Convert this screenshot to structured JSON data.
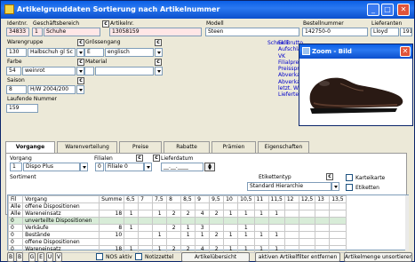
{
  "window": {
    "title": "Artikelgrunddaten Sortierung nach Artikelnummer",
    "accent": "#0b5fe6"
  },
  "header": {
    "identnr_label": "Identnr.",
    "identnr": "34833",
    "geschaeft_label": "Geschäftsbereich",
    "geschaeft_code": "1",
    "geschaeft": "Schuhe",
    "artikelnr_label": "Artikelnr.",
    "artikelnr": "13058159",
    "modell_label": "Modell",
    "modell": "Steen",
    "bestellnummer_label": "Bestellnummer",
    "bestellnummer": "142750-0",
    "lieferanten_label": "Lieferanten",
    "lieferant": "Lloyd",
    "lieferant_nr": "1918"
  },
  "left": {
    "warengruppe_label": "Warengruppe",
    "warengruppe_code": "130",
    "warengruppe": "Halbschuh gl Sc",
    "groessengang_label": "Grössengang",
    "groessengang_code": "E",
    "groessengang": "englisch",
    "farbe_label": "Farbe",
    "farbe_code": "54",
    "farbe": "weinrot",
    "material_label": "Material",
    "saison_label": "Saison",
    "saison_code": "8",
    "saison": "H/W 2004/200",
    "laufende_label": "Laufende Nummer",
    "laufende": "159"
  },
  "side_letters": "Schnelli",
  "links": [
    "Ek Brutto",
    "Aufschlagsfa",
    "VK",
    "Filialpreise",
    "Preissprunge",
    "Abverkauf-M",
    "Abverkauf-We",
    "letzt. Warene",
    "Lieferterm"
  ],
  "zoom": {
    "title": "Zoom - Bild"
  },
  "tabs": [
    "Vorgange",
    "Warenverteilung",
    "Preise",
    "Rabatte",
    "Prämien",
    "Eigenschaften"
  ],
  "panel": {
    "vorgang_label": "Vorgang",
    "vorgang_code": "1",
    "vorgang": "Dispo Plus",
    "filialen_label": "Filialen",
    "filiale_code": "0",
    "filiale": "Filiale 0",
    "lieferdatum_label": "Lieferdatum",
    "lieferdatum": "__.__.____",
    "sortiment_label": "Sortiment",
    "etikettentyp_label": "Etikettentyp",
    "etikettentyp": "Standard Hierarchie",
    "karteikarte_label": "Karteikarte",
    "etiketten_label": "Etiketten"
  },
  "grid": {
    "headers": [
      "Fil",
      "Vorgang",
      "Summe",
      "6,5",
      "7",
      "7,5",
      "8",
      "8,5",
      "9",
      "9,5",
      "10",
      "10,5",
      "11",
      "11,5",
      "12",
      "12,5",
      "13",
      "13,5"
    ],
    "rows": [
      [
        "Alle",
        "offene Dispositionen",
        "",
        "",
        "",
        "",
        "",
        "",
        "",
        "",
        "",
        "",
        "",
        "",
        "",
        "",
        "",
        ""
      ],
      [
        "Alle",
        "Wareneinsatz",
        "18",
        "1",
        "",
        "1",
        "2",
        "2",
        "4",
        "2",
        "1",
        "1",
        "1",
        "1",
        "",
        "",
        "",
        ""
      ],
      [
        "0",
        "unverteilte Dispositionen",
        "",
        "",
        "",
        "",
        "",
        "",
        "",
        "",
        "",
        "",
        "",
        "",
        "",
        "",
        "",
        ""
      ],
      [
        "0",
        "Verkäufe",
        "8",
        "1",
        "",
        "",
        "2",
        "1",
        "3",
        "",
        "",
        "1",
        "",
        "",
        "",
        "",
        "",
        ""
      ],
      [
        "0",
        "Bestände",
        "10",
        "",
        "",
        "1",
        "",
        "1",
        "1",
        "2",
        "1",
        "1",
        "1",
        "1",
        "",
        "",
        "",
        ""
      ],
      [
        "0",
        "offene Dispositionen",
        "",
        "",
        "",
        "",
        "",
        "",
        "",
        "",
        "",
        "",
        "",
        "",
        "",
        "",
        "",
        ""
      ],
      [
        "0",
        "Wareneinsatz",
        "18",
        "1",
        "",
        "1",
        "2",
        "2",
        "4",
        "2",
        "1",
        "1",
        "1",
        "1",
        "",
        "",
        "",
        ""
      ]
    ]
  },
  "bottom": {
    "nav_buttons": [
      "B",
      "B",
      "G",
      "E",
      "U",
      "V"
    ],
    "nos_label": "NOS aktiv",
    "notizzettel_label": "Notizzettel",
    "artikeluebersicht": "Artikelübersicht",
    "filter_entfernen": "aktiven Artikelfilter entfernen",
    "menge_unsortieren": "Artikelmenge unsortieren"
  }
}
